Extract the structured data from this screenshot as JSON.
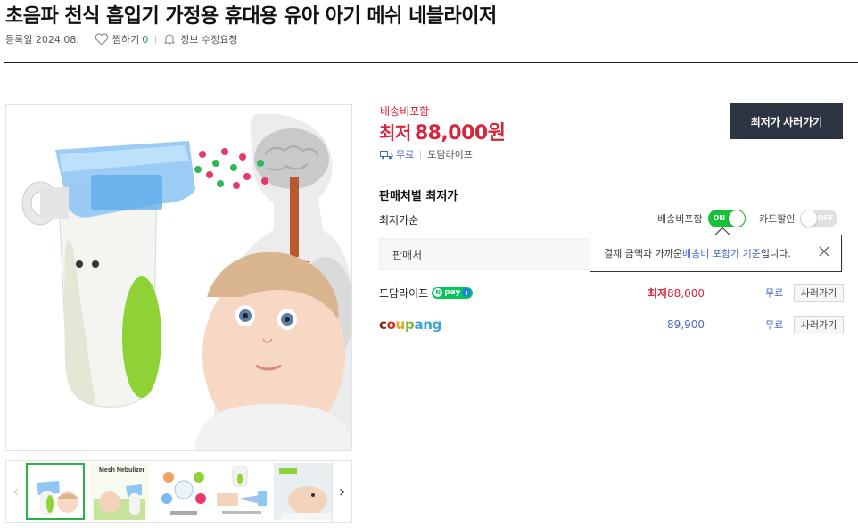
{
  "product": {
    "title": "초음파 천식 흡입기 가정용 휴대용 유아 아기 메쉬 네블라이저",
    "registered": "등록일 2024.08.",
    "like_label": "찜하기",
    "like_count": "0",
    "report_label": "정보 수정요청"
  },
  "price_box": {
    "shipping_tag": "배송비포함",
    "price_prefix": "최저",
    "price": "88,000원",
    "shipping_free": "무료",
    "shop_name": "도담라이프",
    "buy_button": "최저가 사러가기"
  },
  "comparison": {
    "section_title": "판매처별 최저가",
    "sort_label": "최저가순",
    "toggle_shipping_label": "배송비포함",
    "toggle_shipping_state": "ON",
    "toggle_card_label": "카드할인",
    "toggle_card_state": "OFF",
    "header_seller": "판매처",
    "tooltip_pre": "결제 금액과 가까운 ",
    "tooltip_highlight": "배송비 포함가 기준",
    "tooltip_post": "입니다.",
    "rows": [
      {
        "seller": "도담라이프",
        "badge": "pay",
        "price_label": "최저",
        "price": "88,000",
        "shipping": "무료",
        "button": "사러가기"
      },
      {
        "seller": "coupang",
        "price": "89,900",
        "shipping": "무료",
        "button": "사러가기"
      }
    ]
  },
  "thumbnails": {
    "thumb2_caption": "Mesh Nebulizer"
  },
  "colors": {
    "accent_red": "#d8263a",
    "link_blue": "#4767c8",
    "toggle_green": "#16c23a",
    "buy_button_bg": "#2b3440",
    "thumb_active": "#29b14c"
  },
  "icons": [
    "heart-icon",
    "bell-icon",
    "truck-icon",
    "close-icon",
    "chevron-left-icon",
    "chevron-right-icon"
  ]
}
